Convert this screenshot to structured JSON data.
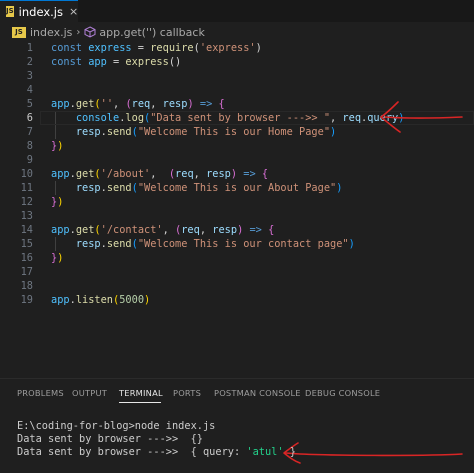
{
  "tab": {
    "label": "index.js",
    "close": "×",
    "badge": "JS"
  },
  "breadcrumb": {
    "file": "index.js",
    "separator": "›",
    "symbol": "app.get('') callback"
  },
  "editor": {
    "active_line": 6,
    "lines": [
      {
        "n": "1",
        "t": [
          [
            "kw",
            "const "
          ],
          [
            "var",
            "express"
          ],
          [
            "pun",
            " = "
          ],
          [
            "fn",
            "require"
          ],
          [
            "pun",
            "("
          ],
          [
            "str",
            "'express'"
          ],
          [
            "pun",
            ")"
          ]
        ]
      },
      {
        "n": "2",
        "t": [
          [
            "kw",
            "const "
          ],
          [
            "var",
            "app"
          ],
          [
            "pun",
            " = "
          ],
          [
            "fn",
            "express"
          ],
          [
            "pun",
            "()"
          ]
        ]
      },
      {
        "n": "3",
        "t": []
      },
      {
        "n": "4",
        "t": []
      },
      {
        "n": "5",
        "t": [
          [
            "var",
            "app"
          ],
          [
            "pun",
            "."
          ],
          [
            "fn",
            "get"
          ],
          [
            "brk1",
            "("
          ],
          [
            "str",
            "''"
          ],
          [
            "pun",
            ", "
          ],
          [
            "brk2",
            "("
          ],
          [
            "prm",
            "req"
          ],
          [
            "pun",
            ", "
          ],
          [
            "prm",
            "resp"
          ],
          [
            "brk2",
            ")"
          ],
          [
            "kw",
            " => "
          ],
          [
            "brk2",
            "{"
          ]
        ]
      },
      {
        "n": "6",
        "t": [
          [
            "pun",
            "    "
          ],
          [
            "var",
            "console"
          ],
          [
            "pun",
            "."
          ],
          [
            "fn",
            "log"
          ],
          [
            "brk3",
            "("
          ],
          [
            "str",
            "\"Data sent by browser --->> \""
          ],
          [
            "pun",
            ", "
          ],
          [
            "prm",
            "req"
          ],
          [
            "pun",
            "."
          ],
          [
            "prm",
            "query"
          ],
          [
            "brk3",
            ")"
          ]
        ]
      },
      {
        "n": "7",
        "t": [
          [
            "pun",
            "    "
          ],
          [
            "prm",
            "resp"
          ],
          [
            "pun",
            "."
          ],
          [
            "fn",
            "send"
          ],
          [
            "brk3",
            "("
          ],
          [
            "str",
            "\"Welcome This is our Home Page\""
          ],
          [
            "brk3",
            ")"
          ]
        ]
      },
      {
        "n": "8",
        "t": [
          [
            "brk2",
            "}"
          ],
          [
            "brk1",
            ")"
          ]
        ]
      },
      {
        "n": "9",
        "t": []
      },
      {
        "n": "10",
        "t": [
          [
            "var",
            "app"
          ],
          [
            "pun",
            "."
          ],
          [
            "fn",
            "get"
          ],
          [
            "brk1",
            "("
          ],
          [
            "str",
            "'/about'"
          ],
          [
            "pun",
            ",  "
          ],
          [
            "brk2",
            "("
          ],
          [
            "prm",
            "req"
          ],
          [
            "pun",
            ", "
          ],
          [
            "prm",
            "resp"
          ],
          [
            "brk2",
            ")"
          ],
          [
            "kw",
            " => "
          ],
          [
            "brk2",
            "{"
          ]
        ]
      },
      {
        "n": "11",
        "t": [
          [
            "pun",
            "    "
          ],
          [
            "prm",
            "resp"
          ],
          [
            "pun",
            "."
          ],
          [
            "fn",
            "send"
          ],
          [
            "brk3",
            "("
          ],
          [
            "str",
            "\"Welcome This is our About Page\""
          ],
          [
            "brk3",
            ")"
          ]
        ]
      },
      {
        "n": "12",
        "t": [
          [
            "brk2",
            "}"
          ],
          [
            "brk1",
            ")"
          ]
        ]
      },
      {
        "n": "13",
        "t": []
      },
      {
        "n": "14",
        "t": [
          [
            "var",
            "app"
          ],
          [
            "pun",
            "."
          ],
          [
            "fn",
            "get"
          ],
          [
            "brk1",
            "("
          ],
          [
            "str",
            "'/contact'"
          ],
          [
            "pun",
            ", "
          ],
          [
            "brk2",
            "("
          ],
          [
            "prm",
            "req"
          ],
          [
            "pun",
            ", "
          ],
          [
            "prm",
            "resp"
          ],
          [
            "brk2",
            ")"
          ],
          [
            "kw",
            " => "
          ],
          [
            "brk2",
            "{"
          ]
        ]
      },
      {
        "n": "15",
        "t": [
          [
            "pun",
            "    "
          ],
          [
            "prm",
            "resp"
          ],
          [
            "pun",
            "."
          ],
          [
            "fn",
            "send"
          ],
          [
            "brk3",
            "("
          ],
          [
            "str",
            "\"Welcome This is our contact page\""
          ],
          [
            "brk3",
            ")"
          ]
        ]
      },
      {
        "n": "16",
        "t": [
          [
            "brk2",
            "}"
          ],
          [
            "brk1",
            ")"
          ]
        ]
      },
      {
        "n": "17",
        "t": []
      },
      {
        "n": "18",
        "t": []
      },
      {
        "n": "19",
        "t": [
          [
            "var",
            "app"
          ],
          [
            "pun",
            "."
          ],
          [
            "fn",
            "listen"
          ],
          [
            "brk1",
            "("
          ],
          [
            "num",
            "5000"
          ],
          [
            "brk1",
            ")"
          ]
        ]
      }
    ]
  },
  "panel": {
    "tabs": [
      {
        "label": "PROBLEMS"
      },
      {
        "label": "OUTPUT"
      },
      {
        "label": "TERMINAL",
        "active": true
      },
      {
        "label": "PORTS"
      },
      {
        "label": "POSTMAN CONSOLE"
      },
      {
        "label": "DEBUG CONSOLE"
      }
    ]
  },
  "terminal": {
    "command_line": "E:\\coding-for-blog>node index.js",
    "output1": "Data sent by browser --->>  {}",
    "output2_prefix": "Data sent by browser --->>  { query: ",
    "output2_value": "'atul'",
    "output2_suffix": " }"
  },
  "annotations": {
    "arrow_color": "#d92525"
  },
  "colors": {
    "background": "#1f1f1f",
    "accent": "#0078d4"
  }
}
